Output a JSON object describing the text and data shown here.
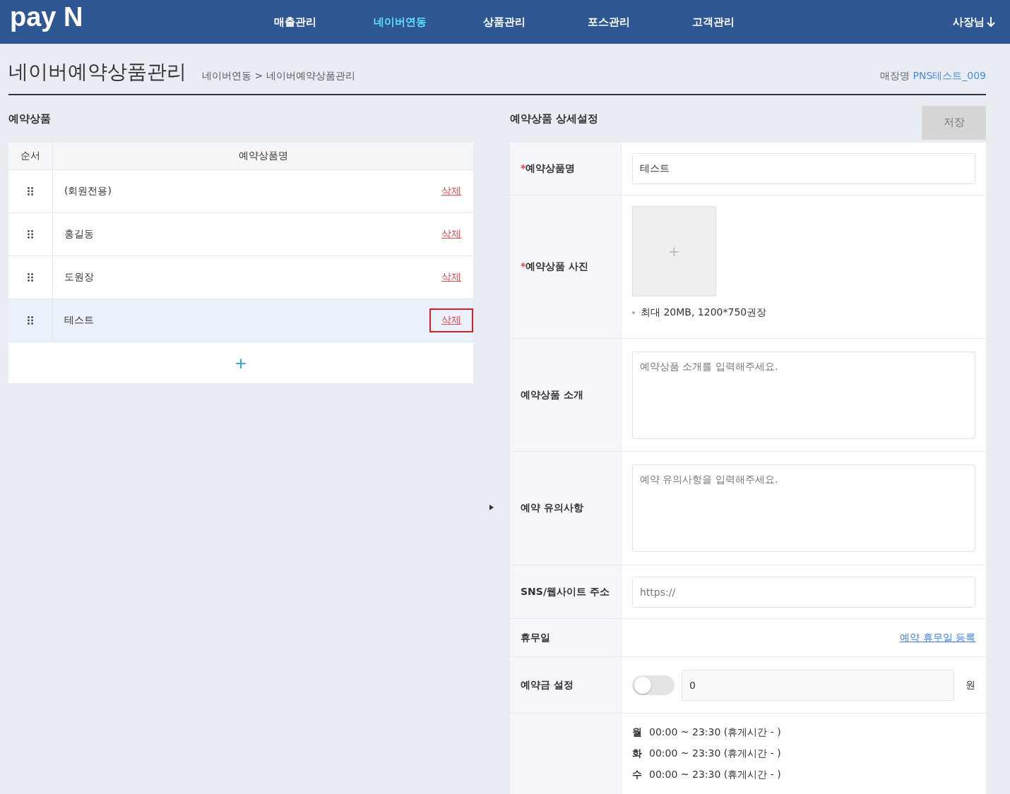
{
  "header": {
    "logo": "pay N",
    "nav": [
      {
        "label": "매출관리",
        "selected": false
      },
      {
        "label": "네이버연동",
        "selected": true
      },
      {
        "label": "상품관리",
        "selected": false
      },
      {
        "label": "포스관리",
        "selected": false
      },
      {
        "label": "고객관리",
        "selected": false
      }
    ],
    "user": "사장님"
  },
  "page": {
    "title": "네이버예약상품관리",
    "breadcrumb": "네이버연동 > 네이버예약상품관리",
    "store_label": "매장명",
    "store_name": "PNS테스트_009"
  },
  "product_list": {
    "title": "예약상품",
    "columns": [
      "순서",
      "예약상품명"
    ],
    "rows": [
      {
        "name": "(회원전용)",
        "delete": "삭제",
        "selected": false,
        "marked": false
      },
      {
        "name": "홍길동",
        "delete": "삭제",
        "selected": false,
        "marked": false
      },
      {
        "name": "도원장",
        "delete": "삭제",
        "selected": false,
        "marked": false
      },
      {
        "name": "테스트",
        "delete": "삭제",
        "selected": true,
        "marked": true
      }
    ],
    "add": "+"
  },
  "detail": {
    "title": "예약상품 상세설정",
    "save": "저장",
    "save_disabled": true,
    "name": {
      "required": "*",
      "label": "예약상품명",
      "value": "테스트"
    },
    "photo": {
      "required": "*",
      "label": "예약상품 사진",
      "add": "+",
      "note": "최대 20MB, 1200*750권장"
    },
    "intro": {
      "label": "예약상품 소개",
      "placeholder": "예약상품 소개를 입력해주세요."
    },
    "notice": {
      "label": "예약 유의사항",
      "placeholder": "예약 유의사항을 입력해주세요."
    },
    "sns": {
      "label": "SNS/웹사이트 주소",
      "placeholder": "https://"
    },
    "holiday": {
      "label": "휴무일",
      "link": "예약 휴무일 등록"
    },
    "deposit": {
      "label": "예약금 설정",
      "on": false,
      "value": "0",
      "unit": "원"
    },
    "schedule": [
      {
        "day": "월",
        "time": "00:00 ~ 23:30 (휴게시간 - )"
      },
      {
        "day": "화",
        "time": "00:00 ~ 23:30 (휴게시간 - )"
      },
      {
        "day": "수",
        "time": "00:00 ~ 23:30 (휴게시간 - )"
      }
    ]
  }
}
